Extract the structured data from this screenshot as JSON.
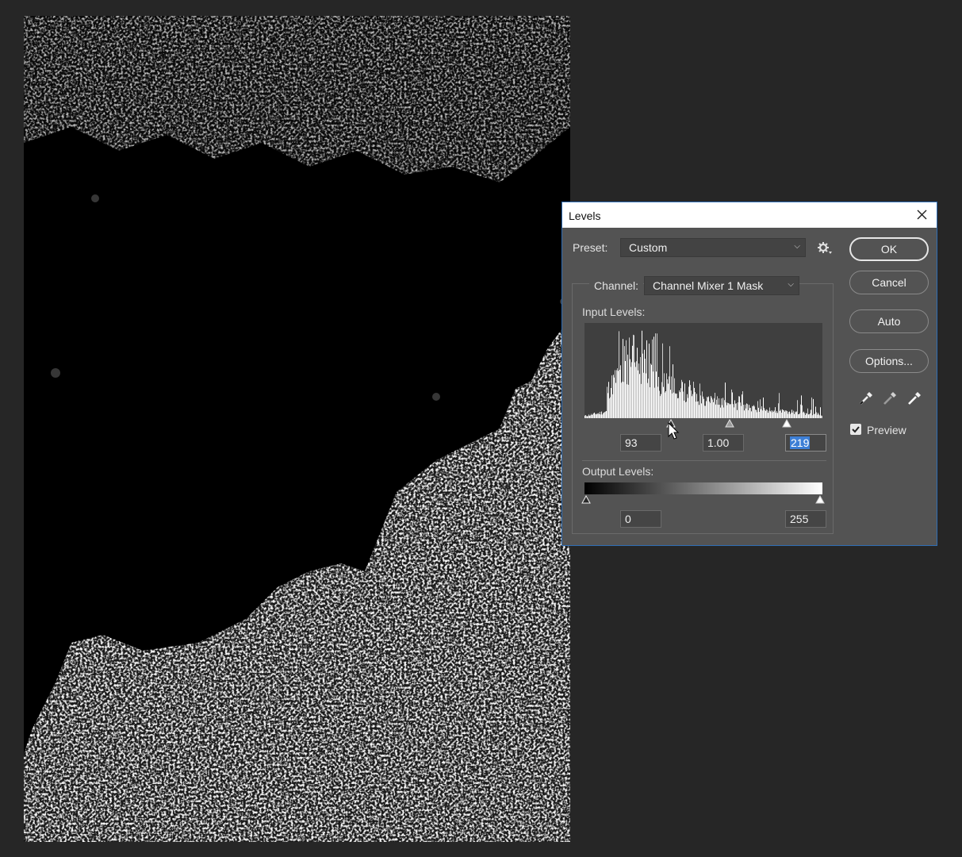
{
  "dialog": {
    "title": "Levels",
    "preset_label": "Preset:",
    "preset_value": "Custom",
    "channel_label": "Channel:",
    "channel_value": "Channel Mixer 1 Mask",
    "input_levels_label": "Input Levels:",
    "input_black": "93",
    "input_gamma": "1.00",
    "input_white": "219",
    "output_levels_label": "Output Levels:",
    "output_black": "0",
    "output_white": "255",
    "buttons": {
      "ok": "OK",
      "cancel": "Cancel",
      "auto": "Auto",
      "options": "Options..."
    },
    "preview_label": "Preview",
    "preview_checked": true,
    "input_slider_values": {
      "black": 93,
      "gamma": 1.0,
      "white": 219
    },
    "output_slider_values": {
      "black": 0,
      "white": 255
    }
  },
  "colors": {
    "dialog_bg": "#535353",
    "dialog_border": "#2f6db5",
    "selection_highlight": "#3d7fd6",
    "workspace_bg": "#262626"
  },
  "icons": {
    "close": "close-icon",
    "gear": "gear-icon",
    "eyedroppers": [
      "black-point-eyedropper-icon",
      "gray-point-eyedropper-icon",
      "white-point-eyedropper-icon"
    ]
  }
}
